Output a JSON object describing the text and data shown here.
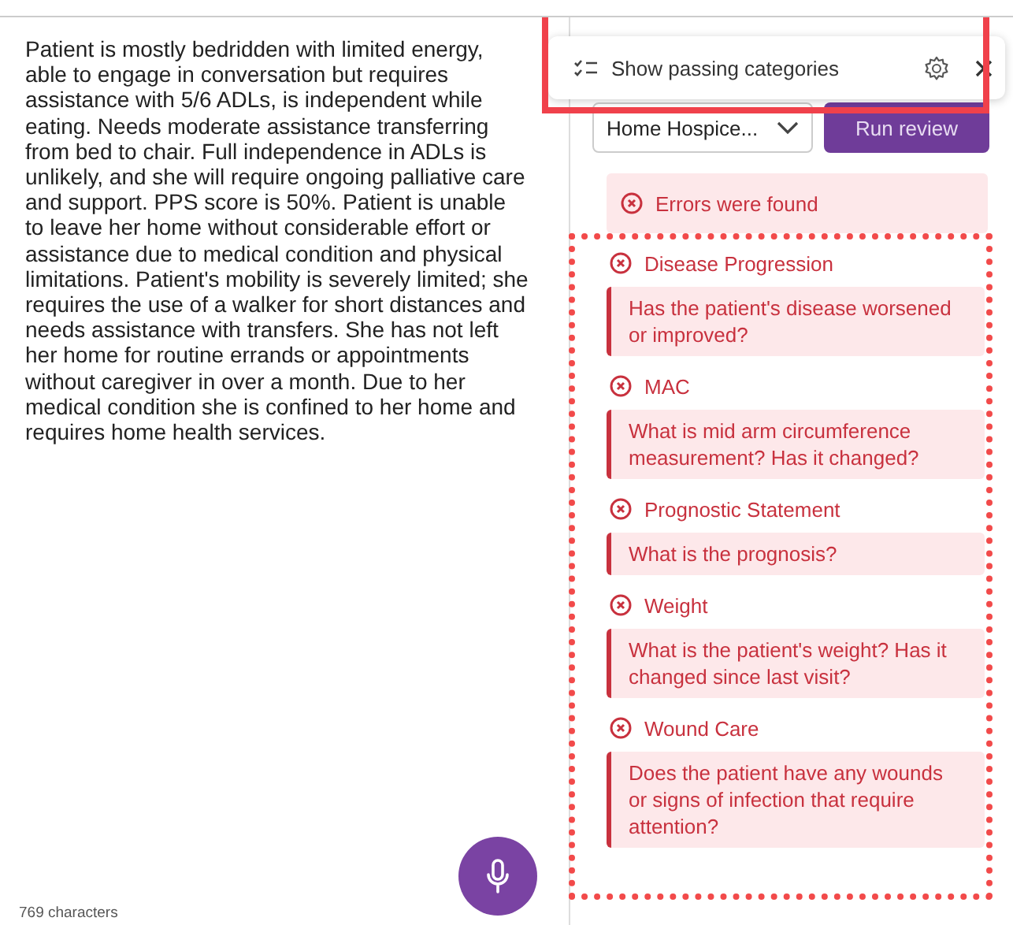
{
  "note": {
    "text": "Patient is mostly bedridden with limited energy, able to engage in conversation but requires assistance with 5/6 ADLs, is independent while eating. Needs moderate assistance transferring from bed to chair. Full independence in ADLs is unlikely, and she will require ongoing palliative care and support. PPS score is 50%. Patient is unable to leave her home without considerable effort or assistance due to medical condition and physical limitations. Patient's mobility is severely limited; she requires the use of a walker for short distances and needs assistance with transfers. She has not left her home for routine errands or appointments without caregiver in over a month. Due to her medical condition she is confined to her home and requires home health services.",
    "char_count": "769 characters"
  },
  "popup": {
    "label": "Show passing categories",
    "annotated": true
  },
  "review": {
    "template": "Home Hospice...",
    "button": "Run review"
  },
  "summary": {
    "text": "Errors were found"
  },
  "categories_annotated": true,
  "categories": [
    {
      "title": "Disease Progression",
      "message": "Has the patient's disease worsened or improved?"
    },
    {
      "title": "MAC",
      "message": "What is mid arm circumference measurement? Has it changed?"
    },
    {
      "title": "Prognostic Statement",
      "message": "What is the prognosis?"
    },
    {
      "title": "Weight",
      "message": "What is the patient's weight? Has it changed since last visit?"
    },
    {
      "title": "Wound Care",
      "message": "Does the patient have any wounds or signs of infection that require attention?"
    }
  ]
}
